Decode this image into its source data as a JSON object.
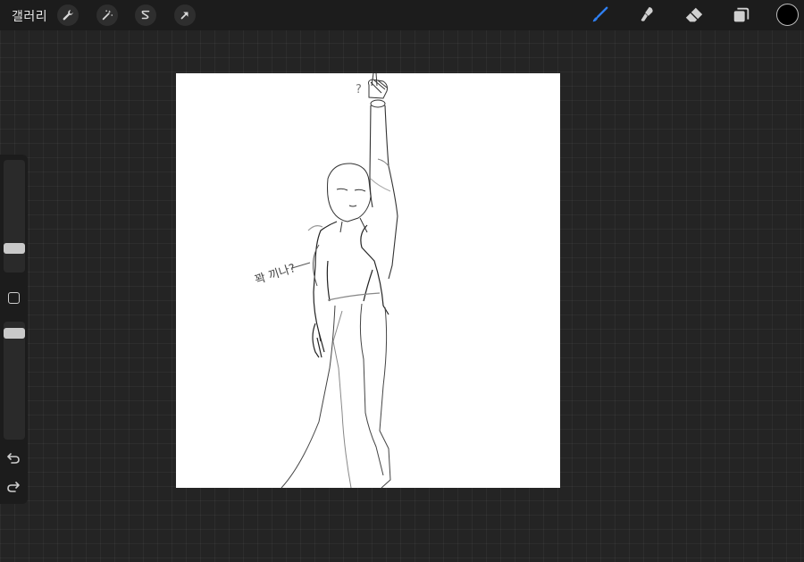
{
  "toolbar": {
    "gallery_label": "갤러리",
    "left_tools": [
      {
        "name": "actions",
        "icon": "wrench-icon"
      },
      {
        "name": "adjustments",
        "icon": "magic-wand-icon"
      },
      {
        "name": "selection",
        "icon": "selection-s-icon"
      },
      {
        "name": "transform",
        "icon": "arrow-cursor-icon"
      }
    ],
    "right_tools": [
      {
        "name": "brush",
        "icon": "brush-icon",
        "active": true
      },
      {
        "name": "smudge",
        "icon": "smudge-icon",
        "active": false
      },
      {
        "name": "eraser",
        "icon": "eraser-icon",
        "active": false
      },
      {
        "name": "layers",
        "icon": "layers-icon",
        "active": false
      }
    ],
    "active_color": "#000000",
    "accent_color": "#2f7ff0"
  },
  "sidebar": {
    "brush_size_level": 0.18,
    "opacity_level": 0.94,
    "buttons": [
      "modify-square-icon",
      "undo-icon",
      "redo-icon"
    ]
  },
  "canvas": {
    "background": "#ffffff",
    "annotation": "꽉 끼나?",
    "question_mark": "?"
  }
}
